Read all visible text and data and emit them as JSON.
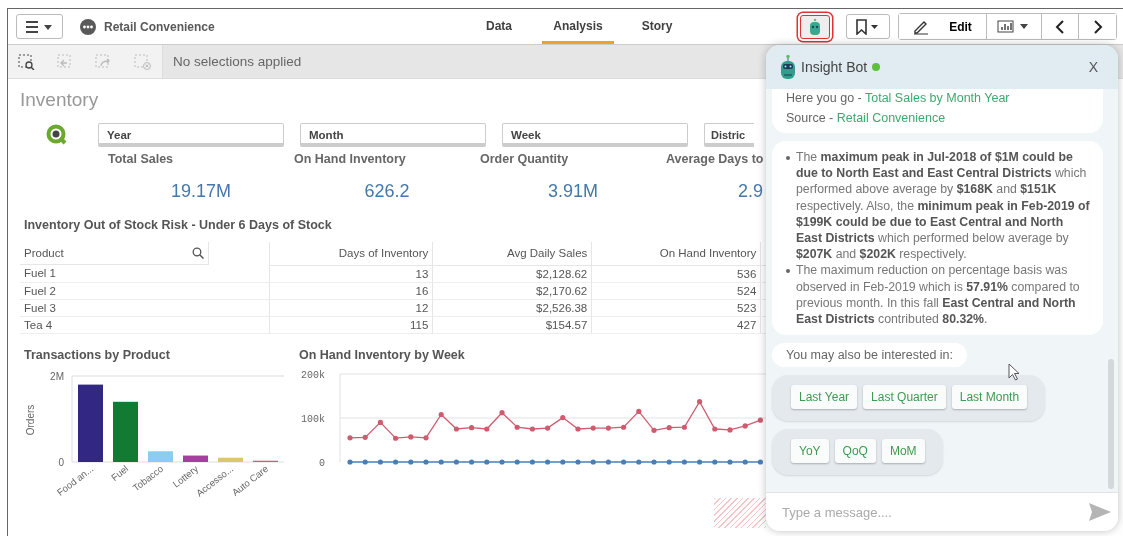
{
  "top_bar": {
    "app_title": "Retail Convenience",
    "tabs": [
      {
        "label": "Data",
        "selected": false
      },
      {
        "label": "Analysis",
        "selected": true
      },
      {
        "label": "Story",
        "selected": false
      }
    ],
    "bot_button": {
      "highlighted": true
    },
    "edit_button": "Edit"
  },
  "selection_bar": {
    "tools": [
      {
        "kind": "search",
        "disabled": false
      },
      {
        "kind": "back",
        "disabled": true
      },
      {
        "kind": "forward",
        "disabled": true
      },
      {
        "kind": "clear",
        "disabled": true
      }
    ],
    "status": "No selections applied"
  },
  "sheet": {
    "title": "Inventory",
    "filters": [
      "Year",
      "Month",
      "Week",
      "Distric"
    ],
    "kpis": [
      {
        "label": "Total Sales",
        "value": "19.17M"
      },
      {
        "label": "On Hand Inventory",
        "value": "626.2"
      },
      {
        "label": "Order Quantity",
        "value": "3.91M"
      },
      {
        "label": "Average Days to",
        "value": "2.9"
      }
    ],
    "table": {
      "title": "Inventory Out of Stock Risk - Under 6 Days of Stock",
      "columns": [
        "Product",
        "Days of Inventory",
        "Avg Daily Sales",
        "On Hand Inventory"
      ],
      "rows": [
        [
          "Fuel 1",
          "13",
          "$2,128.62",
          "536"
        ],
        [
          "Fuel 2",
          "16",
          "$2,170.62",
          "524"
        ],
        [
          "Fuel 3",
          "12",
          "$2,526.38",
          "523"
        ],
        [
          "Tea 4",
          "115",
          "$154.57",
          "427"
        ]
      ]
    },
    "bar_chart": {
      "chart_data": {
        "type": "bar",
        "title": "Transactions by Product",
        "ylabel": "Orders",
        "categories": [
          "Food an...",
          "Fuel",
          "Tobacco",
          "Lottery",
          "Accesso...",
          "Auto Care"
        ],
        "values": [
          1800000,
          1400000,
          250000,
          150000,
          100000,
          30000
        ],
        "colors": [
          "#322782",
          "#137a34",
          "#8bcdf0",
          "#a7409c",
          "#d9c86f",
          "#d9577a"
        ],
        "ylim": [
          0,
          2000000
        ],
        "yticks": [
          {
            "value": 0,
            "label": "0"
          },
          {
            "value": 2000000,
            "label": "2M"
          }
        ]
      }
    },
    "line_chart": {
      "chart_data": {
        "type": "line",
        "title": "On Hand Inventory by Week",
        "ylim": [
          0,
          200000
        ],
        "yticks": [
          {
            "value": 0,
            "label": "0"
          },
          {
            "value": 100000,
            "label": "100k"
          },
          {
            "value": 200000,
            "label": "200k"
          }
        ],
        "series": [
          {
            "color": "#cf5b6e",
            "values": [
              55000,
              56000,
              90000,
              54000,
              57000,
              55000,
              108000,
              75000,
              78000,
              75000,
              112000,
              79000,
              75000,
              77000,
              101000,
              75000,
              77000,
              77000,
              79000,
              115000,
              72000,
              78000,
              79000,
              137000,
              75000,
              73000,
              82000,
              95000
            ]
          },
          {
            "color": "#4a7fb5",
            "values": [
              0,
              0,
              0,
              0,
              0,
              0,
              0,
              0,
              0,
              0,
              0,
              0,
              0,
              0,
              0,
              0,
              0,
              0,
              0,
              0,
              0,
              0,
              0,
              0,
              0,
              0,
              0,
              0
            ]
          }
        ]
      }
    }
  },
  "chat": {
    "title": "Insight Bot",
    "online": true,
    "close": "X",
    "reply": {
      "text": "Here you go - ",
      "link": "Total Sales by Month Year",
      "source_label": "Source - ",
      "source_link": "Retail Convenience"
    },
    "insights": [
      "The **maximum peak in Jul-2018 of $1M could be due to North East and East Central Districts** which performed above average by **$168K** and **$151K** respectively. Also, the **minimum peak in Feb-2019 of $199K could be due to East Central and North East Districts** which performed below average by **$207K** and **$202K** respectively.",
      "The maximum reduction on percentage basis was observed in Feb-2019 which is **57.91%** compared to previous month. In this fall **East Central and North East Districts** contributed **80.32%**."
    ],
    "suggestion_intro": "You may also be interested in:",
    "suggestion_groups": [
      [
        "Last Year",
        "Last Quarter",
        "Last Month"
      ],
      [
        "YoY",
        "QoQ",
        "MoM"
      ]
    ],
    "input": {
      "placeholder": "Type a message...."
    }
  }
}
